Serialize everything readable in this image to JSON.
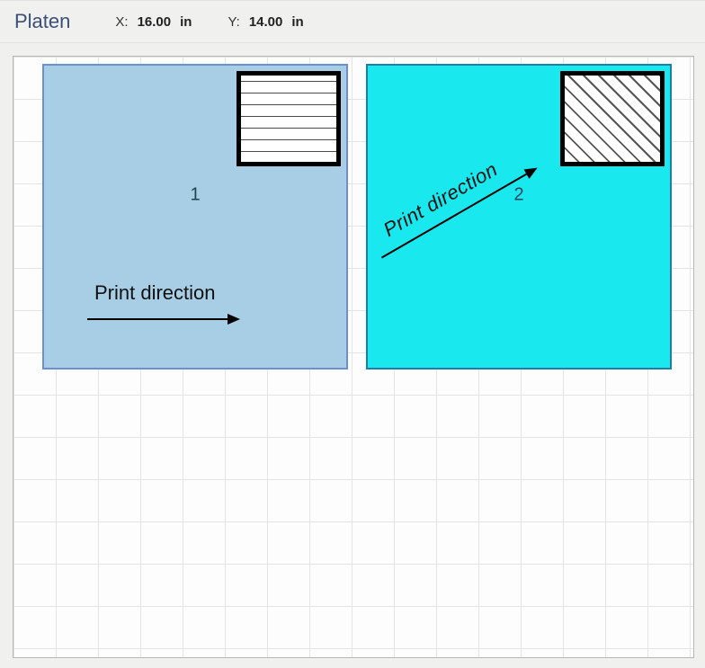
{
  "header": {
    "title": "Platen",
    "x_label": "X:",
    "x_value": "16.00",
    "y_label": "Y:",
    "y_value": "14.00",
    "unit": "in"
  },
  "slots": {
    "s1": {
      "num": "1",
      "direction_label": "Print direction"
    },
    "s2": {
      "num": "2",
      "direction_label": "Print direction"
    }
  }
}
